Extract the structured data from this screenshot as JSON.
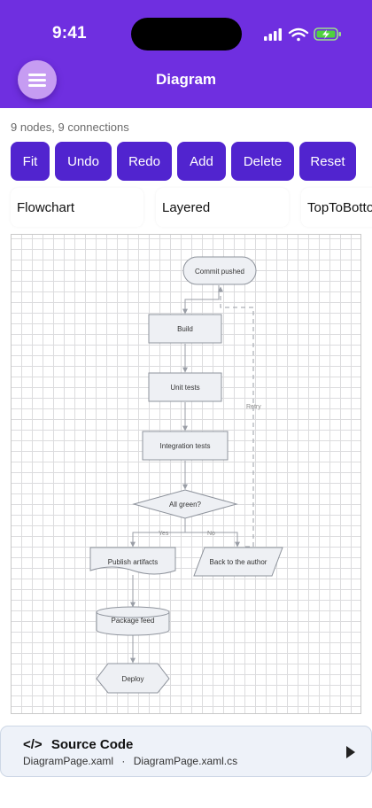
{
  "status_bar": {
    "time": "9:41"
  },
  "app_bar": {
    "title": "Diagram",
    "menu_icon": "hamburger-icon"
  },
  "diagram_info": "9 nodes, 9 connections",
  "toolbar": {
    "fit": "Fit",
    "undo": "Undo",
    "redo": "Redo",
    "add": "Add",
    "delete": "Delete",
    "reset": "Reset"
  },
  "layout_modes": [
    "Flowchart",
    "Layered",
    "TopToBottom"
  ],
  "diagram": {
    "nodes": [
      {
        "id": "commit",
        "shape": "terminator",
        "label": "Commit pushed"
      },
      {
        "id": "build",
        "shape": "process",
        "label": "Build"
      },
      {
        "id": "unit",
        "shape": "process",
        "label": "Unit tests"
      },
      {
        "id": "integration",
        "shape": "process",
        "label": "Integration tests"
      },
      {
        "id": "green",
        "shape": "decision",
        "label": "All green?"
      },
      {
        "id": "publish",
        "shape": "document",
        "label": "Publish artifacts"
      },
      {
        "id": "back",
        "shape": "parallelogram",
        "label": "Back to the author"
      },
      {
        "id": "feed",
        "shape": "cylinder",
        "label": "Package feed"
      },
      {
        "id": "deploy",
        "shape": "hexagon",
        "label": "Deploy"
      }
    ],
    "edges": [
      {
        "from": "commit",
        "to": "build",
        "label": ""
      },
      {
        "from": "build",
        "to": "unit",
        "label": ""
      },
      {
        "from": "unit",
        "to": "integration",
        "label": ""
      },
      {
        "from": "integration",
        "to": "green",
        "label": ""
      },
      {
        "from": "green",
        "to": "publish",
        "label": "Yes"
      },
      {
        "from": "green",
        "to": "back",
        "label": "No"
      },
      {
        "from": "back",
        "to": "build",
        "label": "Retry",
        "dashed": true
      },
      {
        "from": "publish",
        "to": "feed",
        "label": ""
      },
      {
        "from": "feed",
        "to": "deploy",
        "label": ""
      }
    ]
  },
  "source_card": {
    "icon": "</>",
    "title": "Source Code",
    "file_1": "DiagramPage.xaml",
    "separator": "·",
    "file_2": "DiagramPage.xaml.cs"
  },
  "colors": {
    "header": "#6f2fe0",
    "button": "#5124cf",
    "menu_button": "#c69cf2",
    "node_fill": "#eef0f4",
    "node_stroke": "#8e939c",
    "edge": "#9a9ea6"
  }
}
